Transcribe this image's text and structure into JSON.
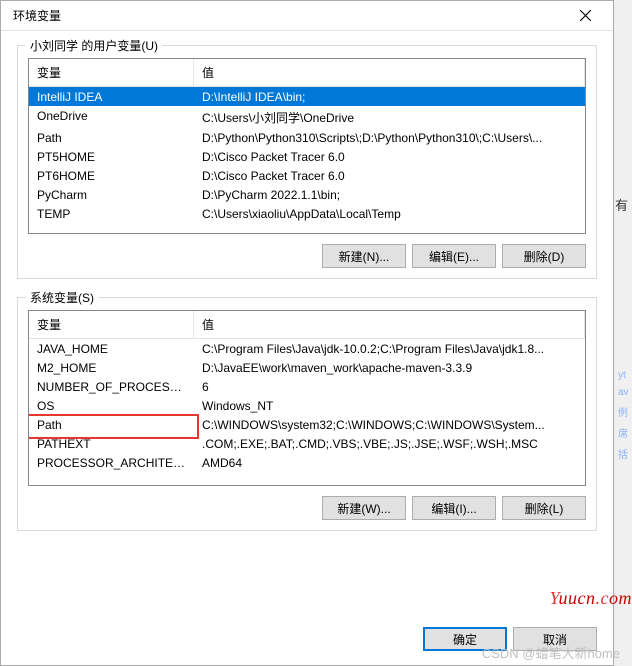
{
  "window": {
    "title": "环境变量"
  },
  "user_vars": {
    "legend": "小刘同学 的用户变量(U)",
    "columns": {
      "name": "变量",
      "value": "值"
    },
    "rows": [
      {
        "name": "IntelliJ IDEA",
        "value": "D:\\IntelliJ IDEA\\bin;",
        "selected": true
      },
      {
        "name": "OneDrive",
        "value": "C:\\Users\\小刘同学\\OneDrive"
      },
      {
        "name": "Path",
        "value": "D:\\Python\\Python310\\Scripts\\;D:\\Python\\Python310\\;C:\\Users\\..."
      },
      {
        "name": "PT5HOME",
        "value": "D:\\Cisco Packet Tracer 6.0"
      },
      {
        "name": "PT6HOME",
        "value": "D:\\Cisco Packet Tracer 6.0"
      },
      {
        "name": "PyCharm",
        "value": "D:\\PyCharm 2022.1.1\\bin;"
      },
      {
        "name": "TEMP",
        "value": "C:\\Users\\xiaoliu\\AppData\\Local\\Temp"
      }
    ],
    "buttons": {
      "new": "新建(N)...",
      "edit": "编辑(E)...",
      "delete": "删除(D)"
    }
  },
  "system_vars": {
    "legend": "系统变量(S)",
    "columns": {
      "name": "变量",
      "value": "值"
    },
    "rows": [
      {
        "name": "JAVA_HOME",
        "value": "C:\\Program Files\\Java\\jdk-10.0.2;C:\\Program Files\\Java\\jdk1.8..."
      },
      {
        "name": "M2_HOME",
        "value": "D:\\JavaEE\\work\\maven_work\\apache-maven-3.3.9"
      },
      {
        "name": "NUMBER_OF_PROCESSORS",
        "value": "6"
      },
      {
        "name": "OS",
        "value": "Windows_NT"
      },
      {
        "name": "Path",
        "value": "C:\\WINDOWS\\system32;C:\\WINDOWS;C:\\WINDOWS\\System...",
        "highlighted": true
      },
      {
        "name": "PATHEXT",
        "value": ".COM;.EXE;.BAT;.CMD;.VBS;.VBE;.JS;.JSE;.WSF;.WSH;.MSC"
      },
      {
        "name": "PROCESSOR_ARCHITECT...",
        "value": "AMD64"
      }
    ],
    "buttons": {
      "new": "新建(W)...",
      "edit": "编辑(I)...",
      "delete": "删除(L)"
    }
  },
  "footer": {
    "ok": "确定",
    "cancel": "取消"
  },
  "watermarks": {
    "site": "Yuucn.com",
    "csdn": "CSDN @蜡笔大新home"
  },
  "side": {
    "char": "有"
  }
}
